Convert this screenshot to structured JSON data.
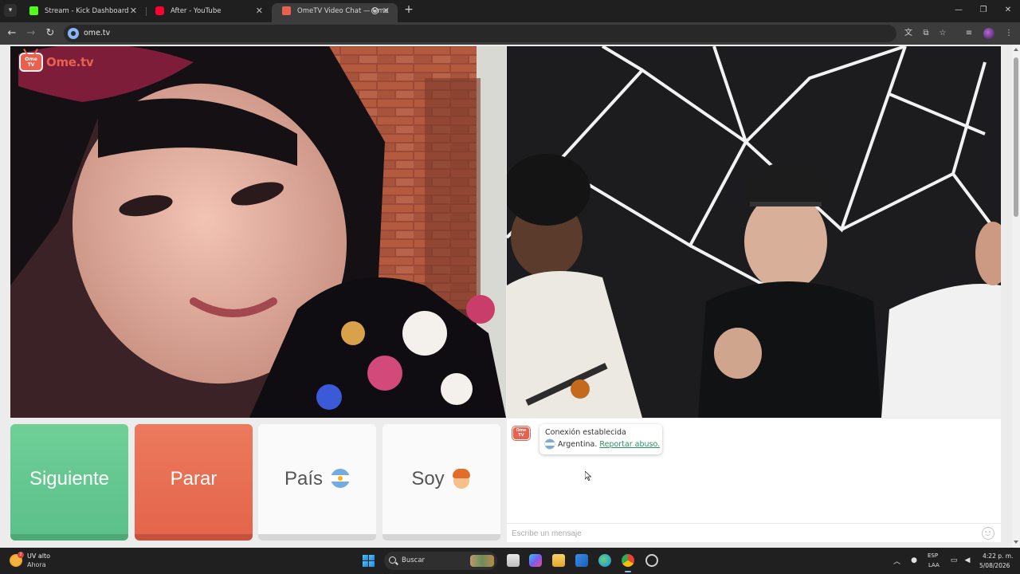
{
  "browser": {
    "tabs": [
      {
        "title": "Stream - Kick Dashboard",
        "favicon_color": "#53fc18",
        "active": false
      },
      {
        "title": "After - YouTube",
        "favicon_color": "#ff0033",
        "active": false
      },
      {
        "title": "OmeTV Video Chat — Ome",
        "favicon_color": "#e8614e",
        "active": true
      }
    ],
    "new_tab_symbol": "+",
    "url": "ome.tv",
    "window_controls": [
      "minimize-icon",
      "restore-icon",
      "close-icon"
    ]
  },
  "page": {
    "logo": {
      "badge_text": "Ome TV",
      "text": "Ome.tv",
      "color": "#e8614e"
    },
    "buttons": {
      "next_label": "Siguiente",
      "stop_label": "Parar",
      "country_label": "País",
      "country_icon": "argentina-flag-icon",
      "gender_label": "Soy",
      "gender_icon": "boy-face-icon"
    },
    "colors": {
      "next": "#6fcf97",
      "stop": "#e8684f",
      "link": "#2f8f60"
    },
    "chat": {
      "avatar_text": "Ome TV",
      "system_message": {
        "title": "Conexión establecida",
        "country_line": "Argentina.",
        "report_link": "Reportar abuso."
      },
      "input_placeholder": "Escribe un mensaje",
      "emoji_icon": "smiley-icon"
    }
  },
  "taskbar": {
    "weather": {
      "badge": "2",
      "line1": "UV alto",
      "line2": "Ahora"
    },
    "search_label": "Buscar",
    "language": {
      "line1": "ESP",
      "line2": "LAA"
    },
    "clock": {
      "time": "4:22 p. m.",
      "date": "5/08/2026"
    }
  }
}
